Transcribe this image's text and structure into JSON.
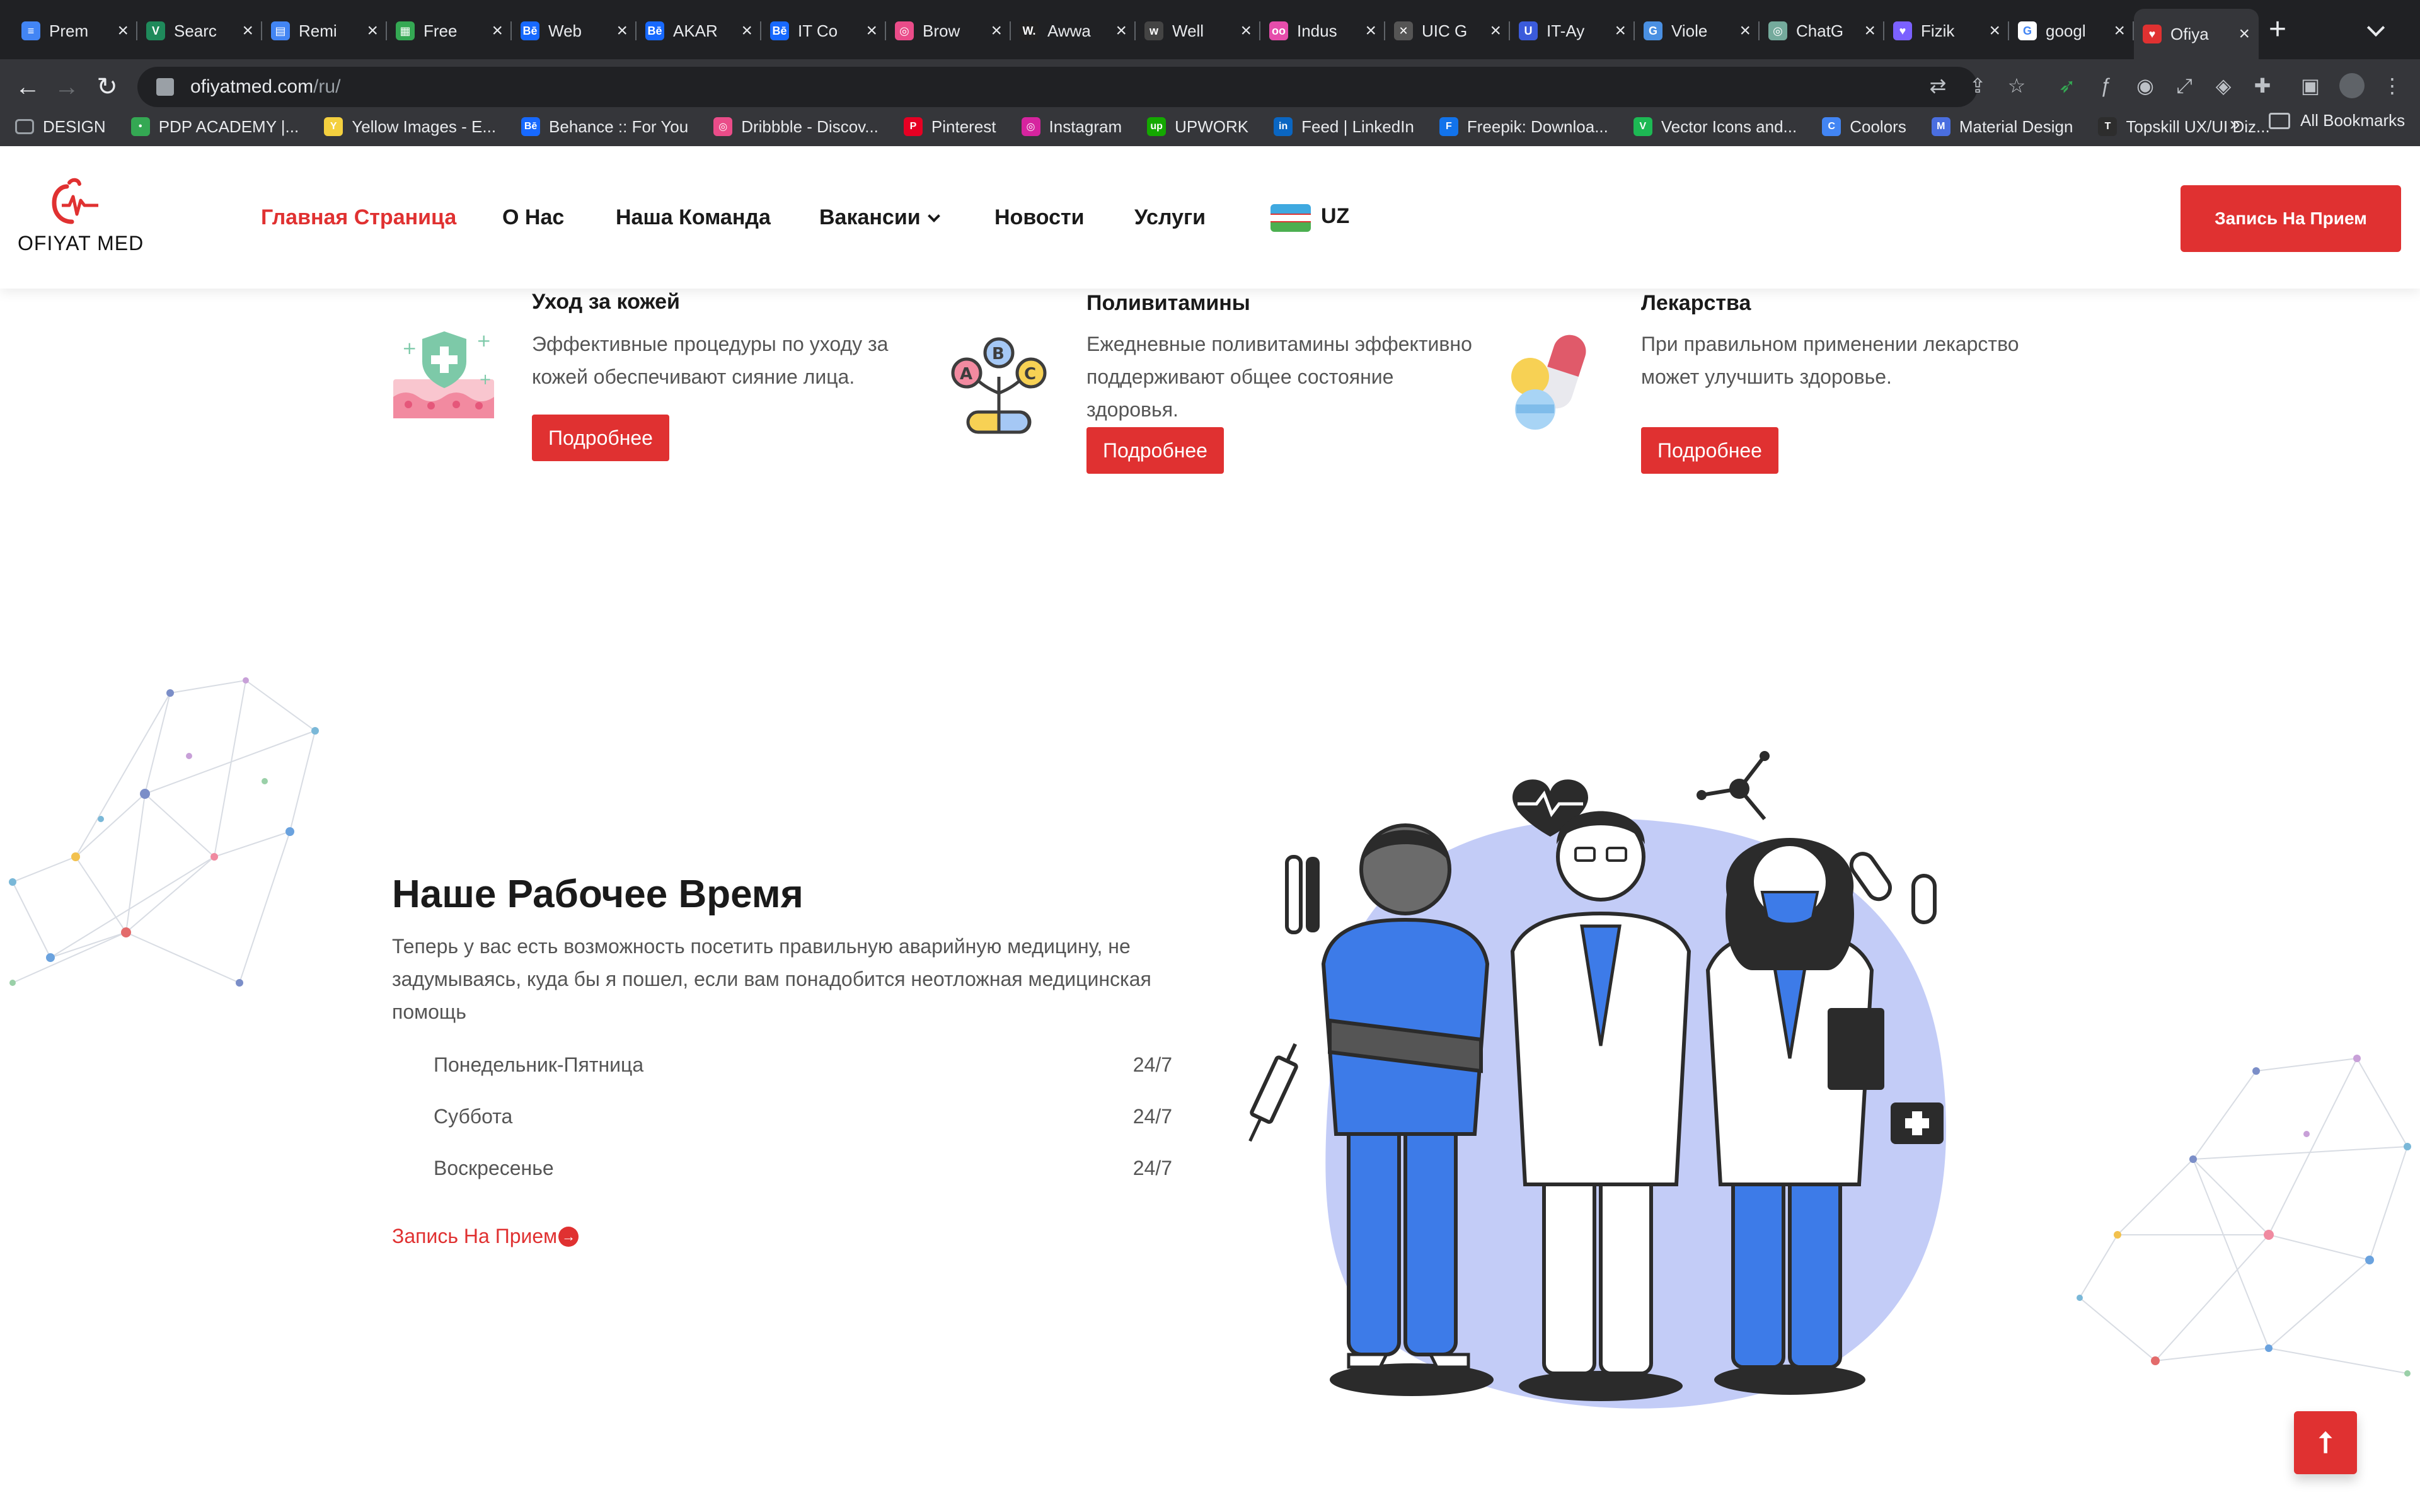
{
  "browser": {
    "tabs": [
      {
        "label": "Prem",
        "color": "#4285f4",
        "glyph": "≡"
      },
      {
        "label": "Searc",
        "color": "#1f8a5b",
        "glyph": "V"
      },
      {
        "label": "Remi",
        "color": "#4285f4",
        "glyph": "▤"
      },
      {
        "label": "Free",
        "color": "#34a853",
        "glyph": "▦"
      },
      {
        "label": "Web",
        "color": "#1769ff",
        "glyph": "Bē"
      },
      {
        "label": "AKAR",
        "color": "#1769ff",
        "glyph": "Bē"
      },
      {
        "label": "IT Co",
        "color": "#1769ff",
        "glyph": "Bē"
      },
      {
        "label": "Brow",
        "color": "#ea4c89",
        "glyph": "◎"
      },
      {
        "label": "Awwa",
        "color": "#222222",
        "glyph": "W."
      },
      {
        "label": "Well",
        "color": "#444444",
        "glyph": "w"
      },
      {
        "label": "Indus",
        "color": "#e64dab",
        "glyph": "oo"
      },
      {
        "label": "UIC G",
        "color": "#555555",
        "glyph": "✕"
      },
      {
        "label": "IT-Ay",
        "color": "#3b5bdb",
        "glyph": "U"
      },
      {
        "label": "Viole",
        "color": "#4a90e2",
        "glyph": "G"
      },
      {
        "label": "ChatG",
        "color": "#74aa9c",
        "glyph": "◎"
      },
      {
        "label": "Fizik",
        "color": "#7b61ff",
        "glyph": "♥"
      },
      {
        "label": "googl",
        "color": "#ffffff",
        "glyph": "G"
      },
      {
        "label": "Ofiya",
        "color": "#e03131",
        "glyph": "♥"
      }
    ],
    "new_tab": "+",
    "url_host": "ofiyatmed.com",
    "url_path": "/ru/",
    "bookmarks": [
      {
        "label": "DESIGN",
        "color": "#9aa0a6",
        "glyph": ""
      },
      {
        "label": "PDP ACADEMY |...",
        "color": "#34a853",
        "glyph": "•"
      },
      {
        "label": "Yellow Images - E...",
        "color": "#f4d03f",
        "glyph": "Y"
      },
      {
        "label": "Behance :: For You",
        "color": "#1769ff",
        "glyph": "Bē"
      },
      {
        "label": "Dribbble - Discov...",
        "color": "#ea4c89",
        "glyph": "◎"
      },
      {
        "label": "Pinterest",
        "color": "#e60023",
        "glyph": "P"
      },
      {
        "label": "Instagram",
        "color": "#d6249f",
        "glyph": "◎"
      },
      {
        "label": "UPWORK",
        "color": "#14a800",
        "glyph": "up"
      },
      {
        "label": "Feed | LinkedIn",
        "color": "#0a66c2",
        "glyph": "in"
      },
      {
        "label": "Freepik: Downloa...",
        "color": "#1273eb",
        "glyph": "F"
      },
      {
        "label": "Vector Icons and...",
        "color": "#1db954",
        "glyph": "V"
      },
      {
        "label": "Coolors",
        "color": "#4285f4",
        "glyph": "C"
      },
      {
        "label": "Material Design",
        "color": "#4a6ee0",
        "glyph": "M"
      },
      {
        "label": "Topskill UX/UI Diz...",
        "color": "#2d2d2d",
        "glyph": "T"
      }
    ],
    "bookmarks_more": "»",
    "all_bookmarks": "All Bookmarks"
  },
  "header": {
    "logo_text": "OFIYAT MED",
    "nav": {
      "home": "Главная Страница",
      "about": "О Нас",
      "team": "Наша Команда",
      "vacancies": "Вакансии",
      "news": "Новости",
      "services": "Услуги"
    },
    "lang": "UZ",
    "cta": "Запись На Прием"
  },
  "services": [
    {
      "title": "Уход за кожей",
      "desc": "Эффективные процедуры по уходу за кожей обеспечивают сияние лица.",
      "button": "Подробнее"
    },
    {
      "title": "Поливитамины",
      "desc": "Ежедневные поливитамины эффективно поддерживают общее состояние здоровья.",
      "button": "Подробнее"
    },
    {
      "title": "Лекарства",
      "desc": "При правильном применении лекарство может улучшить здоровье.",
      "button": "Подробнее"
    }
  ],
  "vitamins": {
    "a": "A",
    "b": "B",
    "c": "C"
  },
  "working_hours": {
    "title": "Наше Рабочее Время",
    "desc": "Теперь у вас есть возможность посетить правильную аварийную медицину, не задумываясь, куда бы я пошел, если вам понадобится неотложная медицинская помощь",
    "schedule": [
      {
        "day": "Понедельник-Пятница",
        "hours": "24/7"
      },
      {
        "day": "Суббота",
        "hours": "24/7"
      },
      {
        "day": "Воскресенье",
        "hours": "24/7"
      }
    ],
    "link": "Запись На Прием"
  },
  "scroll_top": "⭡",
  "colors": {
    "accent": "#e03131",
    "illustration_blue": "#3d7be8",
    "blob": "#c3ccf7"
  }
}
